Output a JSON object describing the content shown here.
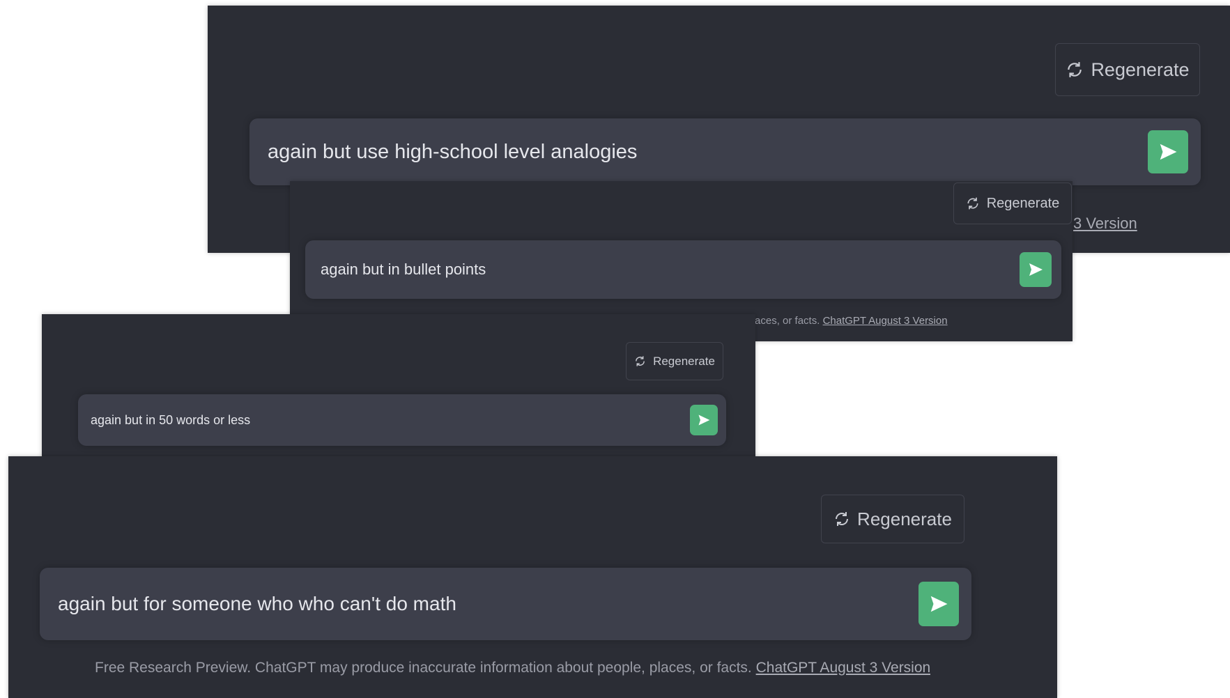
{
  "regenerate_label": "Regenerate",
  "footer_text": "Free Research Preview. ChatGPT may produce inaccurate information about people, places, or facts.",
  "footer_link": "ChatGPT August 3 Version",
  "top_tail_link": "3 Version",
  "send_color": "#4fb27a",
  "prompts": {
    "p1": "again but use high-school level analogies",
    "p2": "again but in bullet points",
    "p3": "again but in 50 words or less",
    "p4": "again but for someone who who can't do math"
  }
}
